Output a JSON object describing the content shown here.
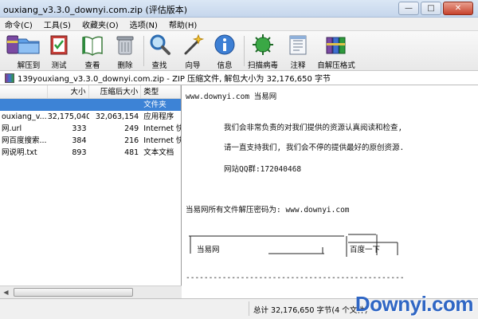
{
  "window": {
    "title": "ouxiang_v3.3.0_downyi.com.zip (评估版本)",
    "minimize": "—",
    "maximize": "□",
    "close": "✕"
  },
  "menu": [
    "命令(C)",
    "工具(S)",
    "收藏夹(O)",
    "选项(N)",
    "帮助(H)"
  ],
  "toolbar": [
    {
      "label": "解压到",
      "icon": "folder-extract-icon"
    },
    {
      "label": "测试",
      "icon": "test-book-icon"
    },
    {
      "label": "查看",
      "icon": "view-book-icon"
    },
    {
      "label": "删除",
      "icon": "trash-icon"
    },
    {
      "label": "查找",
      "icon": "magnifier-icon"
    },
    {
      "label": "向导",
      "icon": "wand-icon"
    },
    {
      "label": "信息",
      "icon": "info-icon"
    },
    {
      "label": "扫描病毒",
      "icon": "virus-scan-icon"
    },
    {
      "label": "注释",
      "icon": "comment-icon"
    },
    {
      "label": "自解压格式",
      "icon": "sfx-icon"
    }
  ],
  "address": "139youxiang_v3.3.0_downyi.com.zip - ZIP 压缩文件, 解包大小为 32,176,650 字节",
  "file_list": {
    "headers": [
      "",
      "大小",
      "压缩后大小",
      "类型"
    ],
    "rows": [
      {
        "name": "",
        "size": "",
        "packed": "",
        "type": "文件夹",
        "selected": true
      },
      {
        "name": "ouxiang_v...",
        "size": "32,175,040",
        "packed": "32,063,154",
        "type": "应用程序"
      },
      {
        "name": "网.url",
        "size": "333",
        "packed": "249",
        "type": "Internet 快"
      },
      {
        "name": "网百度搜索...",
        "size": "384",
        "packed": "216",
        "type": "Internet 快"
      },
      {
        "name": "网说明.txt",
        "size": "893",
        "packed": "481",
        "type": "文本文档"
      }
    ]
  },
  "comment": {
    "line1": "www.downyi.com  当易网",
    "line2": "我们会非常负责的对我们提供的资源认真阅读和检查,",
    "line3": "请一直支持我们, 我们会不停的提供最好的原创资源.",
    "line4": "网站QQ群:172040468",
    "line5": "当易网所有文件解压密码为: www.downyi.com",
    "box_left": "当易网",
    "box_right": "百度一下",
    "divider": "------------------------------------------------"
  },
  "status": "总计 32,176,650 字节(4 个文件)",
  "watermark": "Downyi.com"
}
